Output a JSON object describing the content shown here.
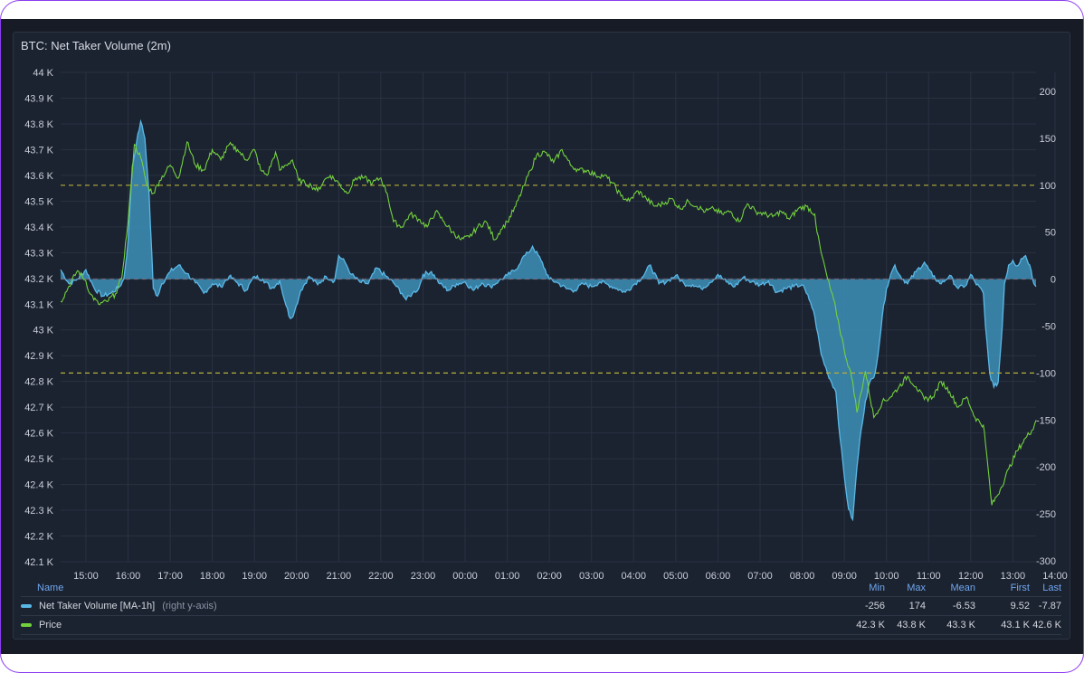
{
  "panel": {
    "title": "BTC: Net Taker Volume (2m)"
  },
  "colors": {
    "price": "#73d13d",
    "volume": "#5ab8e6",
    "volume_fill": "#3d8fb8",
    "threshold": "#b5b03a"
  },
  "chart_data": {
    "type": "line",
    "title": "BTC: Net Taker Volume (2m)",
    "x_ticks": [
      "15:00",
      "16:00",
      "17:00",
      "18:00",
      "19:00",
      "20:00",
      "21:00",
      "22:00",
      "23:00",
      "00:00",
      "01:00",
      "02:00",
      "03:00",
      "04:00",
      "05:00",
      "06:00",
      "07:00",
      "08:00",
      "09:00",
      "10:00",
      "11:00",
      "12:00",
      "13:00",
      "14:00"
    ],
    "x_range_hours_from_1500": [
      -0.6,
      22.55
    ],
    "y_left": {
      "label": "",
      "ticks": [
        "42.1 K",
        "42.2 K",
        "42.3 K",
        "42.4 K",
        "42.5 K",
        "42.6 K",
        "42.7 K",
        "42.8 K",
        "42.9 K",
        "43 K",
        "43.1 K",
        "43.2 K",
        "43.3 K",
        "43.4 K",
        "43.5 K",
        "43.6 K",
        "43.7 K",
        "43.8 K",
        "43.9 K",
        "44 K"
      ],
      "range": [
        42100,
        44000
      ]
    },
    "y_right": {
      "label": "",
      "ticks": [
        "200",
        "150",
        "100",
        "50",
        "0",
        "-50",
        "-100",
        "-150",
        "-200",
        "-250",
        "-300"
      ],
      "range": [
        -300,
        200
      ]
    },
    "thresholds_right_axis": [
      100,
      -100
    ],
    "series": [
      {
        "name": "Price",
        "axis": "left",
        "points": [
          [
            -0.6,
            43110
          ],
          [
            -0.4,
            43170
          ],
          [
            -0.2,
            43230
          ],
          [
            0.0,
            43190
          ],
          [
            0.1,
            43140
          ],
          [
            0.3,
            43100
          ],
          [
            0.5,
            43110
          ],
          [
            0.7,
            43140
          ],
          [
            0.85,
            43200
          ],
          [
            1.0,
            43420
          ],
          [
            1.15,
            43720
          ],
          [
            1.3,
            43670
          ],
          [
            1.45,
            43560
          ],
          [
            1.6,
            43530
          ],
          [
            1.75,
            43580
          ],
          [
            2.0,
            43640
          ],
          [
            2.2,
            43590
          ],
          [
            2.4,
            43730
          ],
          [
            2.6,
            43640
          ],
          [
            2.8,
            43620
          ],
          [
            3.0,
            43700
          ],
          [
            3.2,
            43660
          ],
          [
            3.4,
            43720
          ],
          [
            3.6,
            43700
          ],
          [
            3.8,
            43660
          ],
          [
            4.0,
            43700
          ],
          [
            4.15,
            43620
          ],
          [
            4.3,
            43600
          ],
          [
            4.5,
            43690
          ],
          [
            4.6,
            43620
          ],
          [
            4.75,
            43640
          ],
          [
            4.9,
            43660
          ],
          [
            5.05,
            43580
          ],
          [
            5.2,
            43570
          ],
          [
            5.35,
            43560
          ],
          [
            5.5,
            43540
          ],
          [
            5.65,
            43580
          ],
          [
            5.8,
            43600
          ],
          [
            6.0,
            43570
          ],
          [
            6.2,
            43530
          ],
          [
            6.4,
            43590
          ],
          [
            6.6,
            43590
          ],
          [
            6.8,
            43570
          ],
          [
            7.0,
            43590
          ],
          [
            7.15,
            43530
          ],
          [
            7.3,
            43420
          ],
          [
            7.5,
            43400
          ],
          [
            7.7,
            43450
          ],
          [
            7.9,
            43430
          ],
          [
            8.1,
            43400
          ],
          [
            8.3,
            43460
          ],
          [
            8.5,
            43420
          ],
          [
            8.7,
            43380
          ],
          [
            8.9,
            43350
          ],
          [
            9.1,
            43360
          ],
          [
            9.3,
            43400
          ],
          [
            9.5,
            43420
          ],
          [
            9.7,
            43350
          ],
          [
            9.85,
            43390
          ],
          [
            10.0,
            43420
          ],
          [
            10.2,
            43480
          ],
          [
            10.4,
            43560
          ],
          [
            10.55,
            43620
          ],
          [
            10.7,
            43680
          ],
          [
            10.9,
            43690
          ],
          [
            11.1,
            43650
          ],
          [
            11.3,
            43700
          ],
          [
            11.5,
            43640
          ],
          [
            11.7,
            43620
          ],
          [
            11.9,
            43620
          ],
          [
            12.1,
            43600
          ],
          [
            12.3,
            43600
          ],
          [
            12.5,
            43570
          ],
          [
            12.7,
            43520
          ],
          [
            12.9,
            43500
          ],
          [
            13.1,
            43540
          ],
          [
            13.3,
            43510
          ],
          [
            13.5,
            43480
          ],
          [
            13.7,
            43490
          ],
          [
            13.9,
            43510
          ],
          [
            14.1,
            43470
          ],
          [
            14.3,
            43500
          ],
          [
            14.5,
            43480
          ],
          [
            14.7,
            43460
          ],
          [
            14.9,
            43470
          ],
          [
            15.1,
            43450
          ],
          [
            15.3,
            43460
          ],
          [
            15.5,
            43420
          ],
          [
            15.7,
            43490
          ],
          [
            15.9,
            43460
          ],
          [
            16.1,
            43450
          ],
          [
            16.3,
            43440
          ],
          [
            16.5,
            43460
          ],
          [
            16.7,
            43430
          ],
          [
            16.9,
            43470
          ],
          [
            17.1,
            43480
          ],
          [
            17.3,
            43450
          ],
          [
            17.35,
            43380
          ],
          [
            17.45,
            43300
          ],
          [
            17.6,
            43200
          ],
          [
            17.8,
            43080
          ],
          [
            18.0,
            42920
          ],
          [
            18.2,
            42800
          ],
          [
            18.3,
            42680
          ],
          [
            18.5,
            42840
          ],
          [
            18.7,
            42660
          ],
          [
            18.9,
            42720
          ],
          [
            19.1,
            42740
          ],
          [
            19.3,
            42780
          ],
          [
            19.5,
            42820
          ],
          [
            19.7,
            42780
          ],
          [
            19.9,
            42730
          ],
          [
            20.1,
            42740
          ],
          [
            20.3,
            42800
          ],
          [
            20.5,
            42760
          ],
          [
            20.7,
            42700
          ],
          [
            20.9,
            42740
          ],
          [
            21.1,
            42660
          ],
          [
            21.3,
            42630
          ],
          [
            21.35,
            42560
          ],
          [
            21.5,
            42320
          ],
          [
            21.7,
            42380
          ],
          [
            21.9,
            42460
          ],
          [
            22.1,
            42530
          ],
          [
            22.3,
            42580
          ],
          [
            22.45,
            42610
          ],
          [
            22.55,
            42650
          ]
        ]
      },
      {
        "name": "Net Taker Volume [MA-1h]",
        "axis": "right",
        "points": [
          [
            -0.6,
            10
          ],
          [
            -0.4,
            -5
          ],
          [
            -0.2,
            0
          ],
          [
            0.0,
            10
          ],
          [
            0.2,
            -10
          ],
          [
            0.4,
            -18
          ],
          [
            0.6,
            -15
          ],
          [
            0.8,
            -8
          ],
          [
            0.9,
            0
          ],
          [
            1.0,
            40
          ],
          [
            1.1,
            120
          ],
          [
            1.2,
            145
          ],
          [
            1.3,
            168
          ],
          [
            1.4,
            150
          ],
          [
            1.5,
            90
          ],
          [
            1.6,
            -10
          ],
          [
            1.7,
            -18
          ],
          [
            1.8,
            -5
          ],
          [
            2.0,
            8
          ],
          [
            2.2,
            15
          ],
          [
            2.4,
            6
          ],
          [
            2.6,
            -4
          ],
          [
            2.8,
            -15
          ],
          [
            3.0,
            -5
          ],
          [
            3.2,
            -8
          ],
          [
            3.4,
            3
          ],
          [
            3.6,
            -4
          ],
          [
            3.8,
            -12
          ],
          [
            4.0,
            3
          ],
          [
            4.2,
            0
          ],
          [
            4.4,
            -10
          ],
          [
            4.6,
            -2
          ],
          [
            4.75,
            -28
          ],
          [
            4.85,
            -42
          ],
          [
            4.95,
            -35
          ],
          [
            5.1,
            -12
          ],
          [
            5.3,
            3
          ],
          [
            5.5,
            -6
          ],
          [
            5.7,
            3
          ],
          [
            5.9,
            -2
          ],
          [
            6.0,
            25
          ],
          [
            6.15,
            18
          ],
          [
            6.3,
            5
          ],
          [
            6.5,
            -3
          ],
          [
            6.7,
            -5
          ],
          [
            6.9,
            12
          ],
          [
            7.1,
            4
          ],
          [
            7.3,
            -4
          ],
          [
            7.5,
            -15
          ],
          [
            7.6,
            -22
          ],
          [
            7.75,
            -15
          ],
          [
            7.9,
            -10
          ],
          [
            8.0,
            5
          ],
          [
            8.2,
            8
          ],
          [
            8.4,
            -5
          ],
          [
            8.6,
            -12
          ],
          [
            8.8,
            -5
          ],
          [
            9.0,
            -3
          ],
          [
            9.2,
            -12
          ],
          [
            9.4,
            -4
          ],
          [
            9.6,
            -8
          ],
          [
            9.8,
            -2
          ],
          [
            10.0,
            4
          ],
          [
            10.2,
            10
          ],
          [
            10.35,
            22
          ],
          [
            10.5,
            28
          ],
          [
            10.6,
            35
          ],
          [
            10.8,
            20
          ],
          [
            11.0,
            0
          ],
          [
            11.2,
            -4
          ],
          [
            11.4,
            -10
          ],
          [
            11.6,
            -12
          ],
          [
            11.8,
            -5
          ],
          [
            12.0,
            -8
          ],
          [
            12.2,
            -3
          ],
          [
            12.4,
            -6
          ],
          [
            12.6,
            -10
          ],
          [
            12.8,
            -14
          ],
          [
            13.0,
            -6
          ],
          [
            13.2,
            2
          ],
          [
            13.4,
            15
          ],
          [
            13.6,
            -5
          ],
          [
            13.8,
            -2
          ],
          [
            14.0,
            4
          ],
          [
            14.2,
            -5
          ],
          [
            14.4,
            -6
          ],
          [
            14.6,
            -10
          ],
          [
            14.8,
            -4
          ],
          [
            15.0,
            5
          ],
          [
            15.2,
            -3
          ],
          [
            15.4,
            -8
          ],
          [
            15.6,
            2
          ],
          [
            15.8,
            -3
          ],
          [
            16.0,
            -6
          ],
          [
            16.2,
            -2
          ],
          [
            16.4,
            -14
          ],
          [
            16.6,
            -10
          ],
          [
            16.8,
            -8
          ],
          [
            17.0,
            -6
          ],
          [
            17.1,
            -15
          ],
          [
            17.2,
            -25
          ],
          [
            17.3,
            -40
          ],
          [
            17.45,
            -80
          ],
          [
            17.6,
            -100
          ],
          [
            17.8,
            -120
          ],
          [
            17.9,
            -170
          ],
          [
            18.0,
            -210
          ],
          [
            18.1,
            -245
          ],
          [
            18.2,
            -256
          ],
          [
            18.3,
            -200
          ],
          [
            18.4,
            -160
          ],
          [
            18.5,
            -130
          ],
          [
            18.6,
            -110
          ],
          [
            18.7,
            -105
          ],
          [
            18.8,
            -80
          ],
          [
            18.9,
            -40
          ],
          [
            19.0,
            -10
          ],
          [
            19.1,
            5
          ],
          [
            19.2,
            15
          ],
          [
            19.3,
            5
          ],
          [
            19.5,
            -5
          ],
          [
            19.7,
            8
          ],
          [
            19.9,
            18
          ],
          [
            20.1,
            3
          ],
          [
            20.3,
            -5
          ],
          [
            20.5,
            4
          ],
          [
            20.7,
            -10
          ],
          [
            20.9,
            -6
          ],
          [
            21.0,
            5
          ],
          [
            21.1,
            -3
          ],
          [
            21.3,
            -15
          ],
          [
            21.35,
            -50
          ],
          [
            21.45,
            -100
          ],
          [
            21.55,
            -115
          ],
          [
            21.65,
            -110
          ],
          [
            21.75,
            -50
          ],
          [
            21.8,
            -5
          ],
          [
            21.9,
            15
          ],
          [
            22.0,
            20
          ],
          [
            22.1,
            14
          ],
          [
            22.2,
            22
          ],
          [
            22.3,
            25
          ],
          [
            22.4,
            15
          ],
          [
            22.5,
            -5
          ],
          [
            22.55,
            -8
          ]
        ]
      }
    ],
    "legend": {
      "headers": {
        "name": "Name",
        "min": "Min",
        "max": "Max",
        "mean": "Mean",
        "first": "First",
        "last": "Last"
      },
      "rows": [
        {
          "name": "Net Taker Volume [MA-1h]",
          "suffix": "(right y-axis)",
          "min": "-256",
          "max": "174",
          "mean": "-6.53",
          "first": "9.52",
          "last": "-7.87"
        },
        {
          "name": "Price",
          "suffix": "",
          "min": "42.3 K",
          "max": "43.8 K",
          "mean": "43.3 K",
          "first": "43.1 K",
          "last": "42.6 K"
        }
      ]
    }
  }
}
